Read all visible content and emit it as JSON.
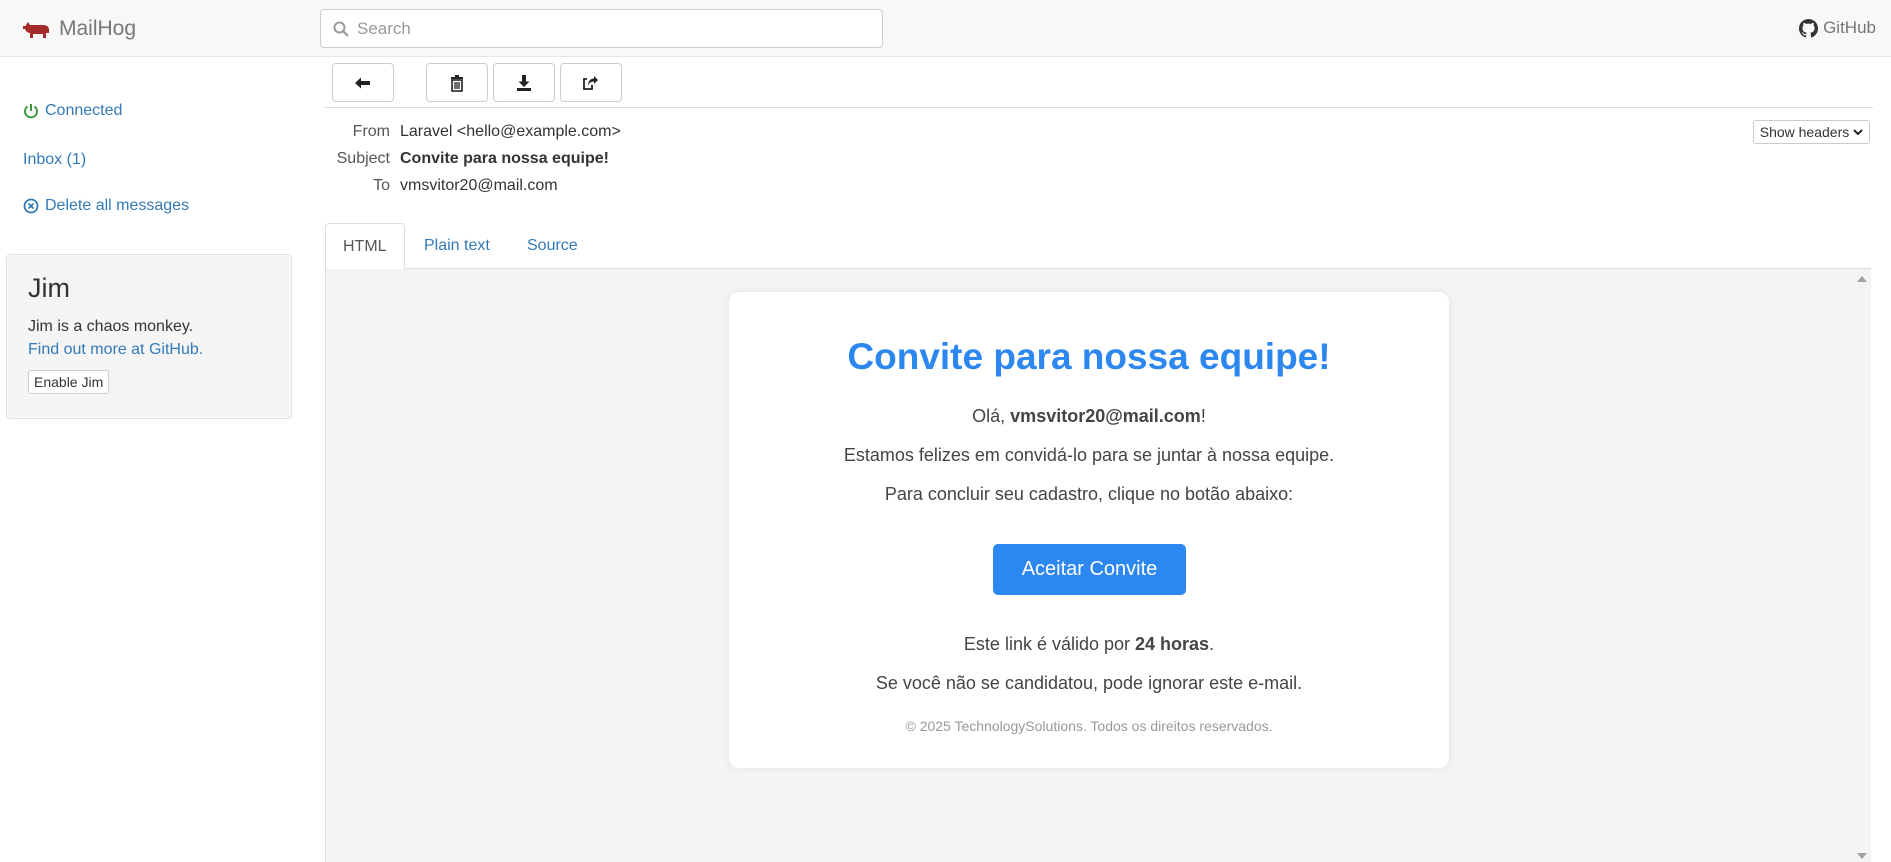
{
  "navbar": {
    "brand": "MailHog",
    "search_placeholder": "Search",
    "github_label": "GitHub"
  },
  "sidebar": {
    "connected": "Connected",
    "inbox": "Inbox (1)",
    "delete_all": "Delete all messages",
    "jim": {
      "title": "Jim",
      "description": "Jim is a chaos monkey.",
      "link": "Find out more at GitHub.",
      "enable_button": "Enable Jim"
    }
  },
  "toolbar": {
    "icons": [
      "arrow-left-icon",
      "trash-icon",
      "download-icon",
      "share-icon"
    ]
  },
  "message": {
    "from_label": "From",
    "from_value": "Laravel <hello@example.com>",
    "subject_label": "Subject",
    "subject_value": "Convite para nossa equipe!",
    "to_label": "To",
    "to_value": "vmsvitor20@mail.com",
    "show_headers": "Show headers"
  },
  "tabs": [
    "HTML",
    "Plain text",
    "Source"
  ],
  "email": {
    "title": "Convite para nossa equipe!",
    "greeting_prefix": "Olá, ",
    "greeting_name": "vmsvitor20@mail.com",
    "greeting_suffix": "!",
    "line1": "Estamos felizes em convidá-lo para se juntar à nossa equipe.",
    "line2": "Para concluir seu cadastro, clique no botão abaixo:",
    "button": "Aceitar Convite",
    "validity_prefix": "Este link é válido por ",
    "validity_bold": "24 horas",
    "validity_suffix": ".",
    "line3": "Se você não se candidatou, pode ignorar este e-mail.",
    "footer": "© 2025 TechnologySolutions. Todos os direitos reservados."
  },
  "colors": {
    "link": "#337ab7",
    "accent": "#2d87f0",
    "connected": "#3c9a3c",
    "brand_logo": "#a52a2a"
  }
}
